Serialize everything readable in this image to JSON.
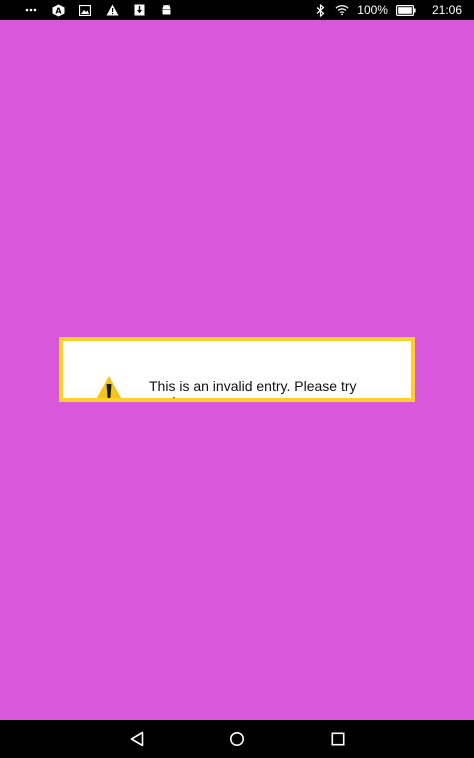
{
  "status_bar": {
    "overflow_dots": "•••",
    "left_icons": [
      "overflow-menu-icon",
      "app-logo-icon",
      "photo-icon",
      "warning-icon",
      "download-icon",
      "android-icon"
    ],
    "right_icons": [
      "bluetooth-icon",
      "wifi-icon",
      "battery-icon"
    ],
    "battery_level": "100%",
    "time": "21:06"
  },
  "alert": {
    "message": "This is an invalid entry. Please try again.",
    "icon": "warning-icon",
    "border_color": "#fcd12a",
    "icon_color": "#f5c518"
  },
  "nav_bar": {
    "buttons": [
      "back-icon",
      "home-icon",
      "recents-icon"
    ]
  },
  "colors": {
    "background": "#d957db",
    "bars": "#000000"
  }
}
